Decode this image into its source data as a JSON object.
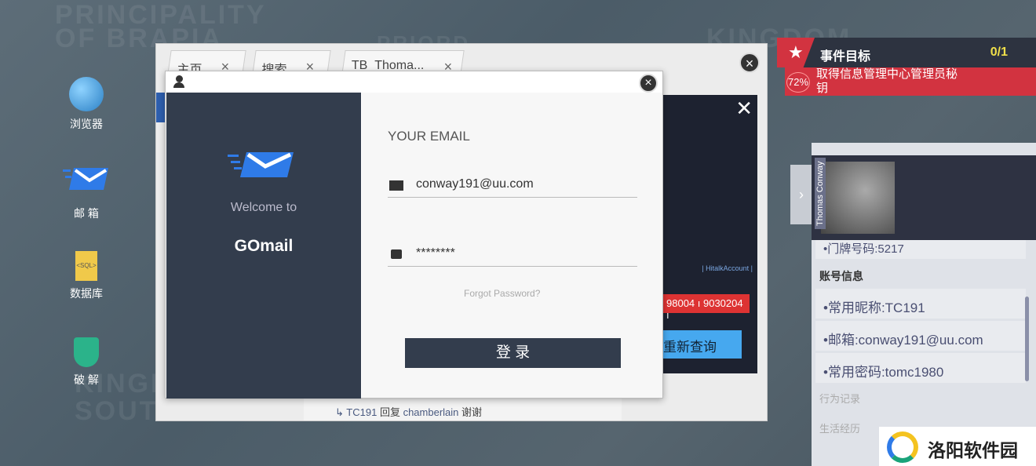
{
  "background": {
    "labels": [
      "PRINCIPALITY",
      "OF BRAPIA",
      "PRIORD",
      "KINGDOM",
      "KINGD",
      "SOUTH"
    ]
  },
  "desktop": [
    {
      "label": "浏览器",
      "icon": "globe-icon"
    },
    {
      "label": "邮 箱",
      "icon": "mail-icon"
    },
    {
      "label": "数据库",
      "icon": "sql-file-icon"
    },
    {
      "label": "破 解",
      "icon": "shield-key-icon"
    }
  ],
  "browser": {
    "tabs": [
      {
        "label": "主页"
      },
      {
        "label": "搜索"
      },
      {
        "label": "TB_Thoma..."
      }
    ],
    "close": "×",
    "behind": {
      "hitalk": "| HitalkAccount |",
      "numbers": "98004 ı 9030204 ı",
      "requery": "重新查询",
      "reply": {
        "user": "TC191",
        "verb": "回复",
        "target": "chamberlain",
        "text": "谢谢"
      }
    }
  },
  "login": {
    "welcome": "Welcome to",
    "app": "GOmail",
    "email_label": "YOUR EMAIL",
    "email": "conway191@uu.com",
    "password": "********",
    "forgot": "Forgot Password?",
    "submit": "登 录",
    "accent": "#2f7be8",
    "panel": "#333d4d"
  },
  "mission": {
    "title": "事件目标",
    "count": "0/1",
    "progress": "72%",
    "task": "取得信息管理中心管理员秘钥",
    "color": "#d23340"
  },
  "profile": {
    "name": "Thomas Conway",
    "partial": "•门牌号码:5217",
    "section": "账号信息",
    "items": [
      "•常用昵称:TC191",
      "•邮箱:conway191@uu.com",
      "•常用密码:tomc1980"
    ],
    "more": [
      "行为记录",
      "生活经历"
    ]
  },
  "watermark": {
    "text": "洛阳软件园"
  }
}
